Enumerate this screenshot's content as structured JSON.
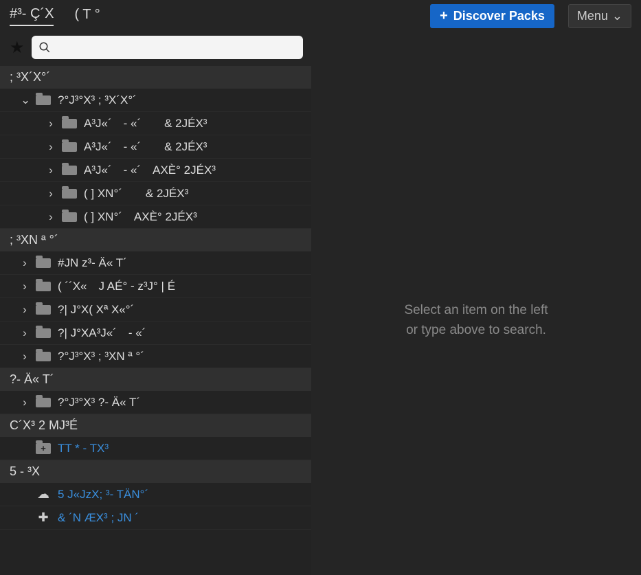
{
  "topbar": {
    "tabs": [
      {
        "label": "#³- Ç´X",
        "active": true
      },
      {
        "label": "( T °",
        "active": false
      }
    ],
    "discover_label": "Discover Packs",
    "menu_label": "Menu"
  },
  "search": {
    "placeholder": ""
  },
  "right_panel": {
    "line1": "Select an item on the left",
    "line2": "or type above to search."
  },
  "tree": {
    "sections": [
      {
        "header": "; ³X´X°´",
        "items": [
          {
            "level": 1,
            "expanded": true,
            "label": "?°J³°X³ ; ³X´X°´"
          },
          {
            "level": 2,
            "expanded": false,
            "label": "A³J«´ - «´  & 2JÉX³"
          },
          {
            "level": 2,
            "expanded": false,
            "label": "A³J«´ - «´  & 2JÉX³"
          },
          {
            "level": 2,
            "expanded": false,
            "label": "A³J«´ - «´ AXÈ° 2JÉX³"
          },
          {
            "level": 2,
            "expanded": false,
            "label": "( ] XN°´  & 2JÉX³"
          },
          {
            "level": 2,
            "expanded": false,
            "label": "( ] XN°´ AXÈ° 2JÉX³"
          }
        ]
      },
      {
        "header": "; ³XN ª °´",
        "items": [
          {
            "level": 1,
            "expanded": false,
            "label": "#JN z³- Ä« T´"
          },
          {
            "level": 1,
            "expanded": false,
            "label": "( ´´X« J AÉ° - z³J° | É"
          },
          {
            "level": 1,
            "expanded": false,
            "label": "?| J°X( Xª X«°´"
          },
          {
            "level": 1,
            "expanded": false,
            "label": "?| J°XA³J«´ - «´"
          },
          {
            "level": 1,
            "expanded": false,
            "label": "?°J³°X³ ; ³XN ª °´"
          }
        ]
      },
      {
        "header": "?- Ä« T´",
        "items": [
          {
            "level": 1,
            "expanded": false,
            "label": "?°J³°X³ ?- Ä« T´"
          }
        ]
      },
      {
        "header": "C´X³ 2 MJ³É",
        "items": [
          {
            "level": 1,
            "icon": "folderplus",
            "label": "TT * - TX³",
            "blue": true
          }
        ]
      },
      {
        "header": "5 - ³X",
        "items": [
          {
            "level": 1,
            "icon": "cloud",
            "label": "5 J«JzX; ³- TÄN°´",
            "blue": true
          },
          {
            "level": 1,
            "icon": "plus",
            "label": "& ´N ÆX³ ; JN ´",
            "blue": true
          }
        ]
      }
    ]
  }
}
